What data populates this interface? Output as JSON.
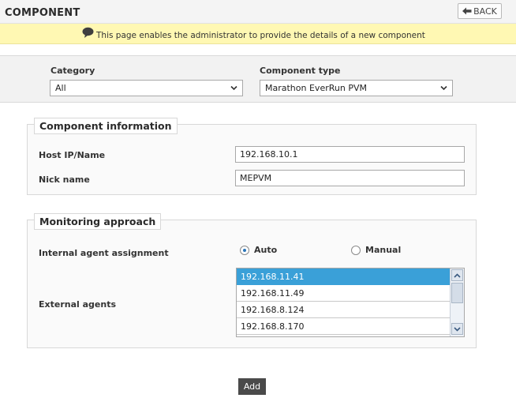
{
  "header": {
    "title": "COMPONENT",
    "back_label": "BACK"
  },
  "info": {
    "text": "This page enables the administrator to provide the details of a new component"
  },
  "filters": {
    "category_label": "Category",
    "category_value": "All",
    "component_type_label": "Component type",
    "component_type_value": "Marathon EverRun PVM"
  },
  "component_info": {
    "legend": "Component information",
    "host_label": "Host IP/Name",
    "host_value": "192.168.10.1",
    "nick_label": "Nick name",
    "nick_value": "MEPVM"
  },
  "monitoring": {
    "legend": "Monitoring approach",
    "internal_label": "Internal agent assignment",
    "auto_label": "Auto",
    "manual_label": "Manual",
    "selected_option": "Auto",
    "external_label": "External agents",
    "agents": [
      "192.168.11.41",
      "192.168.11.49",
      "192.168.8.124",
      "192.168.8.170"
    ],
    "selected_agent": "192.168.11.41"
  },
  "actions": {
    "add_label": "Add"
  },
  "colors": {
    "info_bar": "#fff8b3",
    "selection": "#3aa0d8",
    "add_button": "#4a4a4a"
  }
}
